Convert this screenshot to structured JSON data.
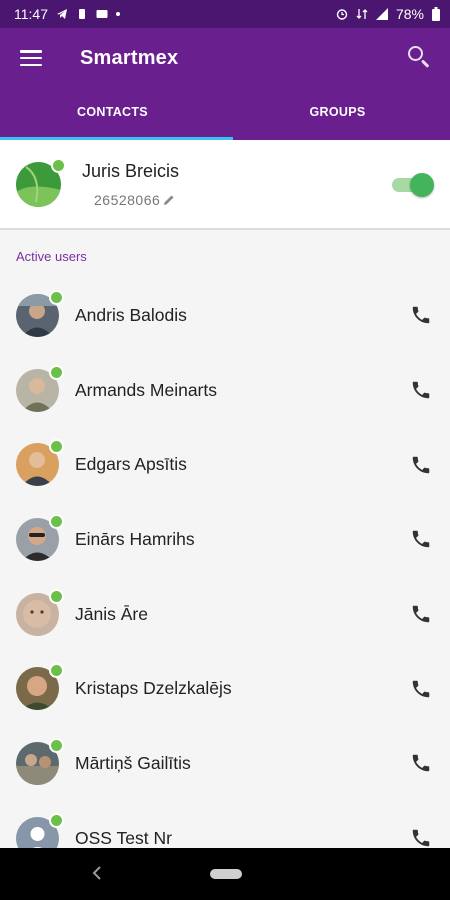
{
  "status_bar": {
    "time": "11:47",
    "battery": "78%"
  },
  "app_bar": {
    "title": "Smartmex"
  },
  "tabs": [
    {
      "label": "CONTACTS",
      "active": true
    },
    {
      "label": "GROUPS",
      "active": false
    }
  ],
  "me": {
    "name": "Juris Breicis",
    "phone": "26528066",
    "online": true,
    "toggle_on": true
  },
  "section": {
    "active_users_label": "Active users"
  },
  "contacts": [
    {
      "name": "Andris Balodis"
    },
    {
      "name": "Armands Meinarts"
    },
    {
      "name": "Edgars Apsītis"
    },
    {
      "name": "Einārs Hamrihs"
    },
    {
      "name": "Jānis Āre"
    },
    {
      "name": "Kristaps Dzelzkalējs"
    },
    {
      "name": "Mārtiņš Gailītis"
    },
    {
      "name": "OSS Test Nr"
    }
  ],
  "colors": {
    "primary": "#6a1f8f",
    "status_bar": "#4a1670",
    "accent": "#39c1ef",
    "online": "#6cc04a"
  }
}
